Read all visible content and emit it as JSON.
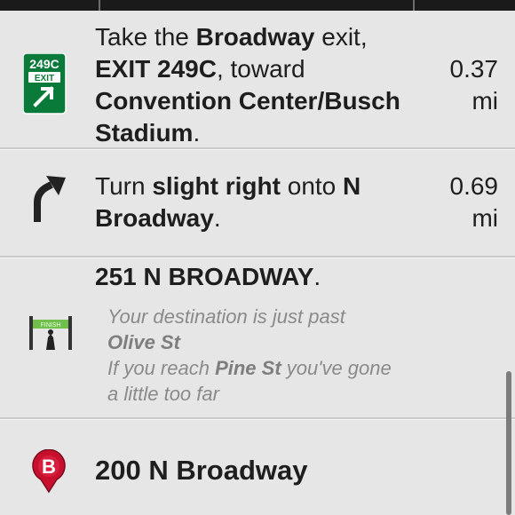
{
  "steps": [
    {
      "icon": "exit-sign-icon",
      "exit_number": "249C",
      "exit_word": "EXIT",
      "t1": "Take the ",
      "b1": "Broadway",
      "t2": " exit, ",
      "b2": "EXIT 249C",
      "t3": ", toward ",
      "b3": "Convention Center/Busch Stadium",
      "t4": ".",
      "distance": "0.37",
      "unit": "mi"
    },
    {
      "icon": "slight-right-arrow-icon",
      "t1": "Turn ",
      "b1": "slight right",
      "t2": " onto ",
      "b2": "N Broadway",
      "t3": ".",
      "distance": "0.69",
      "unit": "mi"
    }
  ],
  "arrival": {
    "icon": "finish-line-icon",
    "finish_label": "FINISH",
    "address": "251 N BROADWAY",
    "address_suffix": ".",
    "note1": "Your destination is just past",
    "note1_street": "Olive St",
    "note2_pre": "If you reach ",
    "note2_street": "Pine St",
    "note2_post": " you've gone",
    "note3": "a little too far"
  },
  "destination": {
    "icon": "map-pin-b-icon",
    "pin_letter": "B",
    "pin_color": "#c8102e",
    "address": "200 N Broadway"
  },
  "colors": {
    "exit_sign_green": "#0a7a3a",
    "background": "#e6e6e6"
  }
}
